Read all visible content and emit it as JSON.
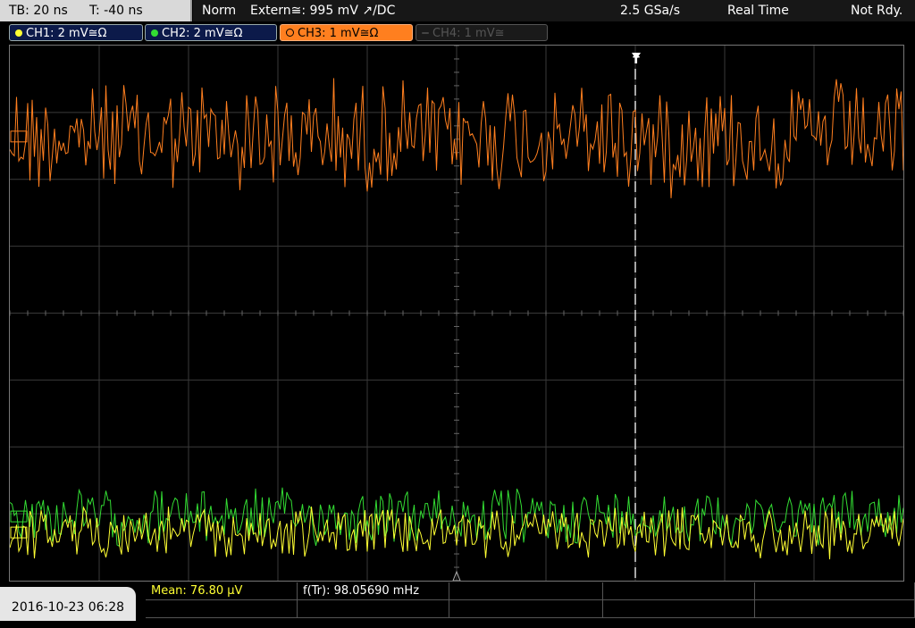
{
  "header": {
    "timebase": "TB: 20 ns",
    "trigger_offset": "T: -40 ns",
    "trigger_mode": "Norm",
    "trigger_source": "Extern≅: 995 mV ↗/DC",
    "sample_rate": "2.5 GSa/s",
    "acq_mode": "Real Time",
    "status": "Not Rdy."
  },
  "channels": [
    {
      "label": "CH1: 2 mV≅Ω",
      "color": "#ffff33",
      "active": true
    },
    {
      "label": "CH2: 2 mV≅Ω",
      "color": "#33dd33",
      "active": true
    },
    {
      "label": "CH3: 1 mV≅Ω",
      "color": "#ff7f1f",
      "active": true
    },
    {
      "label": "CH4: 1 mV≅",
      "color": "#555555",
      "active": false
    }
  ],
  "footer": {
    "datetime": "2016-10-23 06:28",
    "mean": "Mean: 76.80 μV",
    "freq": "f(Tr): 98.05690 mHz"
  },
  "markers": {
    "trigger_top": "T"
  },
  "colors": {
    "ch1": "#ffff33",
    "ch2": "#33dd33",
    "ch3": "#ff7f1f",
    "grid": "#3a3a3a"
  },
  "chart_data": {
    "type": "line",
    "grid": true,
    "series": [
      {
        "channel": "CH3",
        "level_fraction": 0.17,
        "noise_fraction": 0.1
      },
      {
        "channel": "CH2",
        "level_fraction": 0.88,
        "noise_fraction": 0.05
      },
      {
        "channel": "CH1",
        "level_fraction": 0.91,
        "noise_fraction": 0.045
      }
    ]
  }
}
